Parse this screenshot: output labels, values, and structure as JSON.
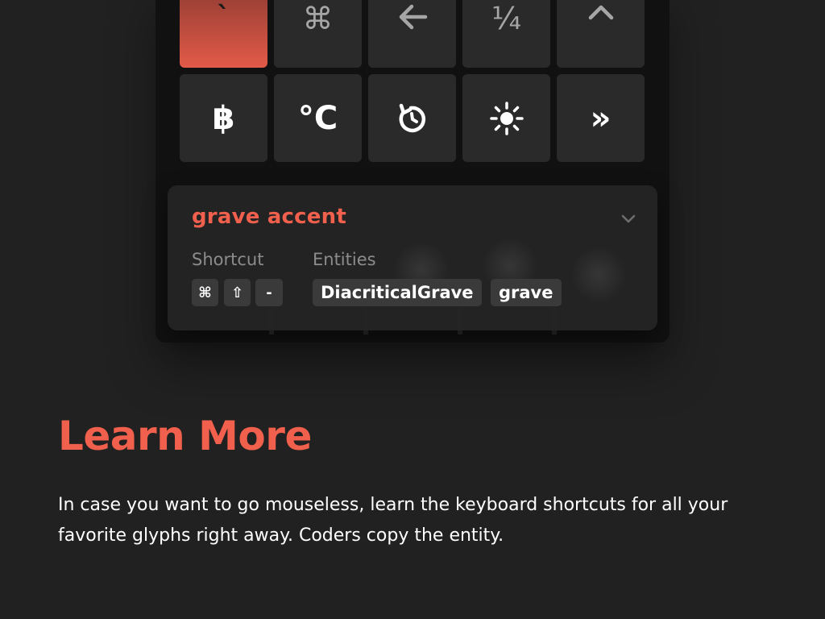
{
  "glyph_grid": {
    "row1": [
      {
        "glyph": "`",
        "icon": "grave-accent",
        "selected": true
      },
      {
        "glyph": "⌘",
        "icon": "command-icon"
      },
      {
        "glyph": "",
        "icon": "arrow-left-icon"
      },
      {
        "glyph": "¼",
        "icon": "one-quarter"
      },
      {
        "glyph": "",
        "icon": "caret-up-icon"
      }
    ],
    "row2": [
      {
        "glyph": "฿",
        "icon": "baht-sign"
      },
      {
        "glyph": "°C",
        "icon": "degree-celsius"
      },
      {
        "glyph": "",
        "icon": "clockwise-arrow-icon"
      },
      {
        "glyph": "",
        "icon": "sun-icon"
      },
      {
        "glyph": "»",
        "icon": "right-guillemet"
      }
    ]
  },
  "detail": {
    "name": "grave accent",
    "shortcut_label": "Shortcut",
    "entities_label": "Entities",
    "shortcut_keys": [
      "⌘",
      "⇧",
      "-"
    ],
    "entities": [
      "DiacriticalGrave",
      "grave"
    ]
  },
  "learn": {
    "title": "Learn More",
    "body": "In case you want to go mouseless, learn the keyboard shortcuts for all your favorite glyphs right away. Coders copy the entity."
  },
  "colors": {
    "accent": "#f0604d",
    "background": "#212121",
    "tile": "#2a2a2a"
  }
}
